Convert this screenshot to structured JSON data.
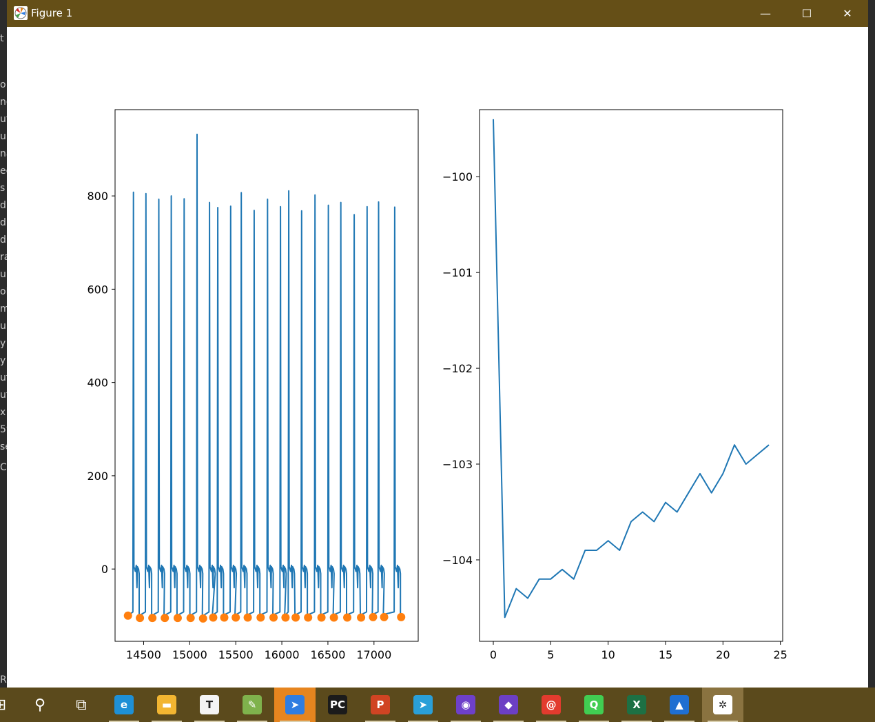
{
  "window": {
    "title": "Figure 1",
    "controls": {
      "minimize": "—",
      "maximize": "☐",
      "close": "✕"
    }
  },
  "background_fragments": [
    "t",
    "o",
    "nc",
    "ut",
    "ui",
    "na",
    "ec",
    "s",
    "di",
    "di",
    "di",
    "ra",
    "ui",
    "ol",
    "m",
    "u",
    "y",
    "y",
    "ut",
    "ut",
    "x",
    "59",
    "se",
    "C",
    "R"
  ],
  "colors": {
    "titlebar": "#654f17",
    "taskbar": "#5b4a1c",
    "line": "#1f77b4",
    "markers": "#ff7f0e"
  },
  "taskbar": {
    "items": [
      {
        "name": "start-icon",
        "glyph": "⊞",
        "color": "transparent"
      },
      {
        "name": "search-icon",
        "glyph": "⚲",
        "color": "transparent"
      },
      {
        "name": "task-view-icon",
        "glyph": "⧉",
        "color": "transparent"
      },
      {
        "name": "edge-icon",
        "glyph": "e",
        "color": "#1e90d6"
      },
      {
        "name": "file-explorer-icon",
        "glyph": "▬",
        "color": "#f2b531"
      },
      {
        "name": "typora-icon",
        "glyph": "T",
        "color": "#f4f4f4"
      },
      {
        "name": "notepad-icon",
        "glyph": "✎",
        "color": "#7fb24c"
      },
      {
        "name": "feishu-icon",
        "glyph": "➤",
        "color": "#2f7de1"
      },
      {
        "name": "pycharm-icon",
        "glyph": "PC",
        "color": "#1b1b1b"
      },
      {
        "name": "powerpoint-icon",
        "glyph": "P",
        "color": "#d04423"
      },
      {
        "name": "telegram-icon",
        "glyph": "➤",
        "color": "#2a9fd8"
      },
      {
        "name": "github-icon",
        "glyph": "◉",
        "color": "#6e40c9"
      },
      {
        "name": "obsidian-icon",
        "glyph": "◆",
        "color": "#6c3fc4"
      },
      {
        "name": "snail-icon",
        "glyph": "@",
        "color": "#e23b2e"
      },
      {
        "name": "qt-icon",
        "glyph": "Q",
        "color": "#41cd52"
      },
      {
        "name": "excel-icon",
        "glyph": "X",
        "color": "#1d7044"
      },
      {
        "name": "photos-icon",
        "glyph": "▲",
        "color": "#1f6fd1"
      },
      {
        "name": "matplotlib-icon",
        "glyph": "✲",
        "color": "#ffffff"
      }
    ]
  },
  "chart_data": [
    {
      "type": "line",
      "title": "",
      "xlabel": "",
      "ylabel": "",
      "xlim": [
        14190,
        17480
      ],
      "ylim": [
        -155,
        985
      ],
      "xticks": [
        14500,
        15000,
        15500,
        16000,
        16500,
        17000
      ],
      "yticks": [
        0,
        200,
        400,
        600,
        800
      ],
      "spikes": {
        "times": [
          14390,
          14525,
          14665,
          14800,
          14940,
          15080,
          15215,
          15305,
          15445,
          15560,
          15700,
          15845,
          15985,
          16075,
          16215,
          16360,
          16505,
          16640,
          16785,
          16925,
          17050,
          17225
        ],
        "peaks": [
          808,
          805,
          793,
          800,
          794,
          932,
          786,
          775,
          778,
          807,
          769,
          793,
          777,
          811,
          768,
          802,
          780,
          786,
          760,
          777,
          787,
          776,
          759
        ]
      },
      "series": [
        {
          "type": "scatter",
          "x": [
            14330,
            14460,
            14595,
            14730,
            14870,
            15010,
            15145,
            15255,
            15375,
            15500,
            15630,
            15770,
            15910,
            16040,
            16150,
            16285,
            16430,
            16565,
            16710,
            16860,
            16990,
            17110,
            17295
          ],
          "y": [
            -100,
            -105,
            -105,
            -105,
            -105,
            -105,
            -106,
            -104,
            -104,
            -104,
            -104,
            -104,
            -104,
            -104,
            -104,
            -104,
            -104,
            -104,
            -104,
            -104,
            -103,
            -103,
            -103
          ]
        }
      ]
    },
    {
      "type": "line",
      "title": "",
      "xlabel": "",
      "ylabel": "",
      "xlim": [
        -1.2,
        25.2
      ],
      "ylim": [
        -104.85,
        -99.3
      ],
      "xticks": [
        0,
        5,
        10,
        15,
        20,
        25
      ],
      "yticks": [
        -104,
        -103,
        -102,
        -101,
        -100
      ],
      "series": [
        {
          "x": [
            0,
            1,
            2,
            3,
            4,
            5,
            6,
            7,
            8,
            9,
            10,
            11,
            12,
            13,
            14,
            15,
            16,
            17,
            18,
            19,
            20,
            21,
            22,
            23,
            24
          ],
          "y": [
            -99.4,
            -104.6,
            -104.3,
            -104.4,
            -104.2,
            -104.2,
            -104.1,
            -104.2,
            -103.9,
            -103.9,
            -103.8,
            -103.9,
            -103.6,
            -103.5,
            -103.6,
            -103.4,
            -103.5,
            -103.3,
            -103.1,
            -103.3,
            -103.1,
            -102.8,
            -103.0,
            -102.9,
            -102.8
          ]
        }
      ]
    }
  ]
}
